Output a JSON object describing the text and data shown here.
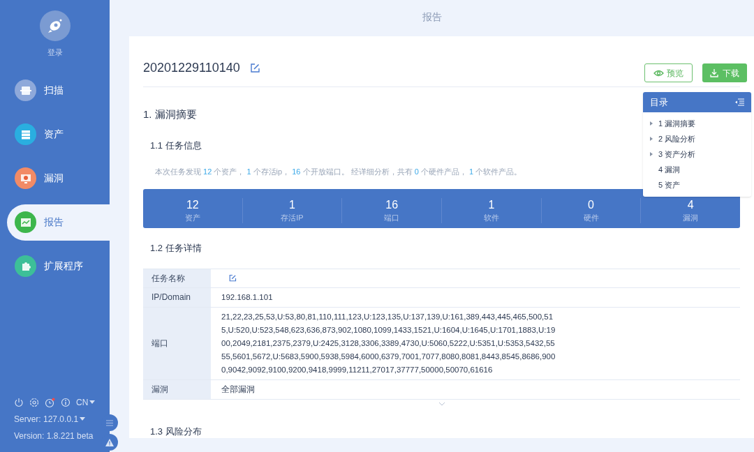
{
  "sidebar": {
    "login_label": "登录",
    "items": [
      {
        "label": "扫描",
        "kind": "scan",
        "color": "#8fa9da",
        "selected": false
      },
      {
        "label": "资产",
        "kind": "asset",
        "color": "#2aaee0",
        "selected": false
      },
      {
        "label": "漏洞",
        "kind": "bug",
        "color": "#f28b66",
        "selected": false
      },
      {
        "label": "报告",
        "kind": "report",
        "color": "#3db64c",
        "selected": true
      },
      {
        "label": "扩展程序",
        "kind": "plugin",
        "color": "#3dbf98",
        "selected": false
      }
    ],
    "footer": {
      "history_alert": true,
      "language": "CN",
      "server": "Server: 127.0.0.1",
      "version": "Version: 1.8.221 beta"
    }
  },
  "header": {
    "title": "报告"
  },
  "report": {
    "title": "20201229110140",
    "buttons": [
      {
        "label": "预览",
        "kind": "preview"
      },
      {
        "label": "下载",
        "kind": "download"
      }
    ],
    "section_1": "1. 漏洞摘要",
    "section_1_1": "1.1 任务信息",
    "summary": [
      {
        "text": "本次任务发现 ",
        "highlight": false
      },
      {
        "text": "12",
        "highlight": true
      },
      {
        "text": " 个资产， ",
        "highlight": false
      },
      {
        "text": "1",
        "highlight": true
      },
      {
        "text": " 个存活ip， ",
        "highlight": false
      },
      {
        "text": "16",
        "highlight": true
      },
      {
        "text": " 个开放端口。 经详细分析，共有 ",
        "highlight": false
      },
      {
        "text": "0",
        "highlight": true
      },
      {
        "text": " 个硬件产品， ",
        "highlight": false
      },
      {
        "text": "1",
        "highlight": true
      },
      {
        "text": " 个软件产品。",
        "highlight": false
      }
    ],
    "stats": [
      {
        "value": "12",
        "label": "资产"
      },
      {
        "value": "1",
        "label": "存活IP"
      },
      {
        "value": "16",
        "label": "端口"
      },
      {
        "value": "1",
        "label": "软件"
      },
      {
        "value": "0",
        "label": "硬件"
      },
      {
        "value": "4",
        "label": "漏洞"
      }
    ],
    "section_1_2": "1.2 任务详情",
    "details": [
      {
        "label": "任务名称",
        "kind": "edit"
      },
      {
        "label": "IP/Domain",
        "value": "192.168.1.101"
      },
      {
        "label": "端口",
        "value": "21,22,23,25,53,U:53,80,81,110,111,123,U:123,135,U:137,139,U:161,389,443,445,465,500,515,U:520,U:523,548,623,636,873,902,1080,1099,1433,1521,U:1604,U:1645,U:1701,1883,U:1900,2049,2181,2375,2379,U:2425,3128,3306,3389,4730,U:5060,5222,U:5351,U:5353,5432,5555,5601,5672,U:5683,5900,5938,5984,6000,6379,7001,7077,8080,8081,8443,8545,8686,9000,9042,9092,9100,9200,9418,9999,11211,27017,37777,50000,50070,61616"
      },
      {
        "label": "漏洞",
        "value": "全部漏洞"
      }
    ],
    "section_1_3": "1.3 风险分布"
  },
  "toc": {
    "title": "目录",
    "items": [
      {
        "label": "1 漏洞摘要",
        "expandable": true
      },
      {
        "label": "2 风险分析",
        "expandable": true
      },
      {
        "label": "3 资产分析",
        "expandable": true
      },
      {
        "label": "4 漏洞",
        "expandable": false
      },
      {
        "label": "5 资产",
        "expandable": false
      }
    ]
  }
}
